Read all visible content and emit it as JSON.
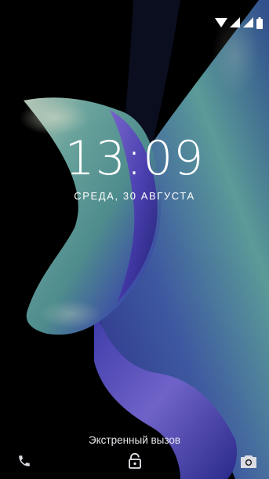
{
  "lockscreen": {
    "time": "13:09",
    "date": "СРЕДА, 30 АВГУСТА",
    "emergency_call_label": "Экстренный вызов"
  },
  "status_bar": {
    "icons": [
      "wifi-icon",
      "signal-icon",
      "signal-icon-2",
      "battery-icon"
    ]
  },
  "bottom_bar": {
    "icons": [
      "phone-icon",
      "lock-icon",
      "camera-icon"
    ]
  },
  "colors": {
    "background": "#000000",
    "text": "#ffffff",
    "wallpaper_teal": "#5f9a97",
    "wallpaper_purple": "#5b3fb4",
    "wallpaper_blue": "#2a2b8c"
  }
}
